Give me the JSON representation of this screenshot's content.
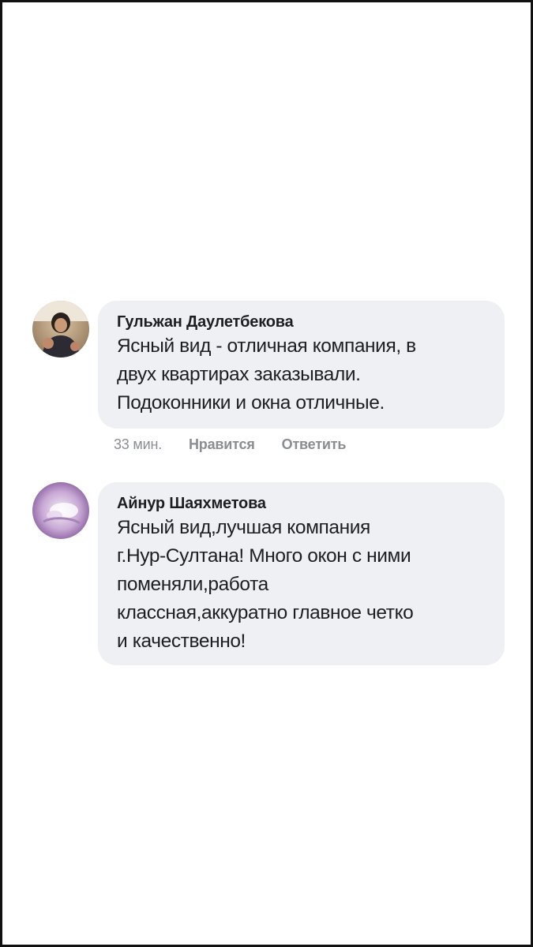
{
  "comments": [
    {
      "author": "Гульжан Даулетбекова",
      "text": "Ясный вид - отличная компания, в\nдвух квартирах заказывали.\nПодоконники  и окна отличные.",
      "time": "33 мин.",
      "like_label": "Нравится",
      "reply_label": "Ответить",
      "avatar_icon": "user-photo-avatar-icon"
    },
    {
      "author": "Айнур Шаяхметова",
      "text": "Ясный вид,лучшая компания\nг.Нур-Султана! Много окон с ними\nпоменяли,работа\nклассная,аккуратно главное  четко\nи качественно!",
      "avatar_icon": "user-photo-avatar-icon"
    }
  ],
  "colors": {
    "bubble": "#eef0f3",
    "text": "#1c1e21",
    "meta": "#8a8d91",
    "frame": "#111111"
  }
}
